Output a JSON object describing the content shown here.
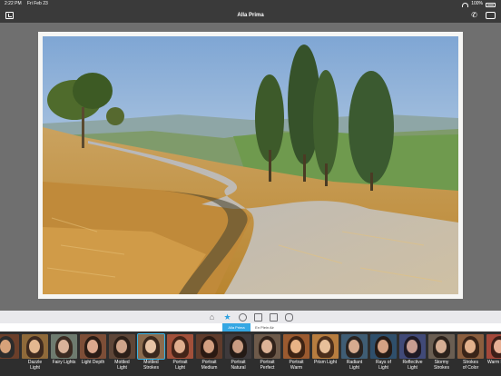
{
  "status_bar": {
    "time": "2:22 PM",
    "date": "Fri Feb 23",
    "battery": "100%"
  },
  "nav": {
    "title": "Alla Prima",
    "phone_icon": "✆"
  },
  "toolbar": {
    "star_icon": "★",
    "home_icon": "⌂"
  },
  "tabs": [
    {
      "label": "Alla Prima",
      "active": true
    },
    {
      "label": "En Plein Air",
      "active": false
    }
  ],
  "presets": [
    {
      "label": "",
      "palette": [
        "#6b3f2a",
        "#d6a27a",
        "#2c2c2c"
      ]
    },
    {
      "label": "Dazzle\nLight",
      "palette": [
        "#8f6a3a",
        "#e3b890",
        "#3e2a1f"
      ]
    },
    {
      "label": "Fairy Lights",
      "palette": [
        "#6e7b6f",
        "#d8b29a",
        "#3b2b22"
      ]
    },
    {
      "label": "Light Depth",
      "palette": [
        "#7d4e37",
        "#dba88d",
        "#2a1c15"
      ]
    },
    {
      "label": "Mottled\nLight",
      "palette": [
        "#5e4638",
        "#cfa48a",
        "#2c1f18"
      ]
    },
    {
      "label": "Mottled\nStrokes",
      "palette": [
        "#8a6b4e",
        "#e6c3a5",
        "#3a281d"
      ],
      "selected": true
    },
    {
      "label": "Portrait\nLight",
      "palette": [
        "#a2503a",
        "#e0ae8e",
        "#442418"
      ]
    },
    {
      "label": "Portrait\nMedium",
      "palette": [
        "#5f3b2b",
        "#d39f80",
        "#2a1912"
      ]
    },
    {
      "label": "Portrait\nNatural",
      "palette": [
        "#3e3a3c",
        "#c99c82",
        "#241a15"
      ]
    },
    {
      "label": "Portrait\nPerfect",
      "palette": [
        "#6d5a4a",
        "#ddb397",
        "#30221a"
      ]
    },
    {
      "label": "Portrait\nWarm",
      "palette": [
        "#9b5a2f",
        "#e8b386",
        "#3d2314"
      ]
    },
    {
      "label": "Prism Light",
      "palette": [
        "#b77d3f",
        "#e8c09a",
        "#4b2e1b"
      ]
    },
    {
      "label": "Radiant\nLight",
      "palette": [
        "#3f5d74",
        "#d6ab8f",
        "#2a2320"
      ]
    },
    {
      "label": "Rays of\nLight",
      "palette": [
        "#2f4f6b",
        "#d4a184",
        "#261b16"
      ]
    },
    {
      "label": "Reflective\nLight",
      "palette": [
        "#414a78",
        "#c79d92",
        "#1f1a25"
      ]
    },
    {
      "label": "Stormy\nStrokes",
      "palette": [
        "#6a5e52",
        "#d5ad93",
        "#2b211b"
      ]
    },
    {
      "label": "Strokes\nof Color",
      "palette": [
        "#8b5e3e",
        "#e1b08c",
        "#3a2418"
      ]
    },
    {
      "label": "Warm Blush",
      "palette": [
        "#a4483a",
        "#e8b095",
        "#3d1f18"
      ]
    }
  ],
  "colors": {
    "accent": "#35a7e3",
    "bar": "#3a3a3a",
    "canvas_bg": "#6f6f6f"
  }
}
